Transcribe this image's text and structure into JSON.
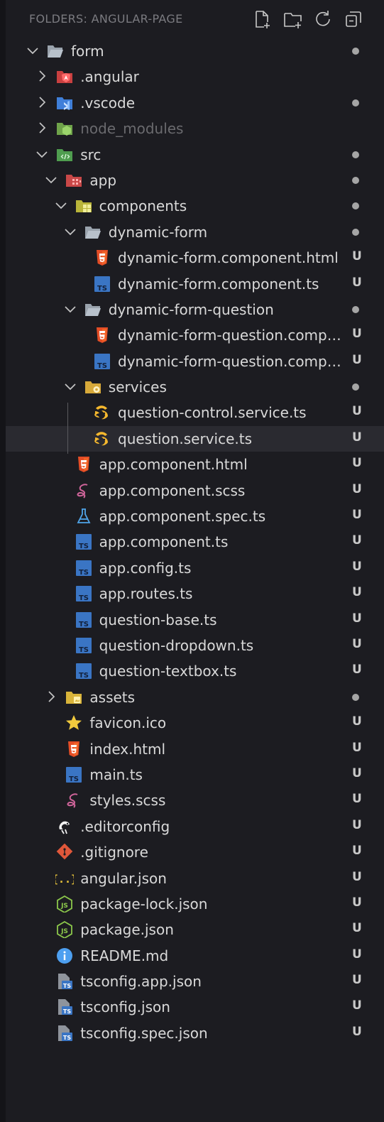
{
  "header": {
    "title": "FOLDERS: ANGULAR-PAGE",
    "buttons": [
      "new-file-icon",
      "new-folder-icon",
      "refresh-icon",
      "collapse-all-icon"
    ]
  },
  "tree": [
    {
      "label": "form",
      "depth": 0,
      "type": "folder",
      "expanded": true,
      "icon": "folder-open-icon",
      "dot": true
    },
    {
      "label": ".angular",
      "depth": 1,
      "type": "folder",
      "expanded": false,
      "icon": "angular-folder-icon",
      "dot": false
    },
    {
      "label": ".vscode",
      "depth": 1,
      "type": "folder",
      "expanded": false,
      "icon": "vscode-folder-icon",
      "dot": true
    },
    {
      "label": "node_modules",
      "depth": 1,
      "type": "folder",
      "expanded": false,
      "icon": "node-folder-icon",
      "dot": false,
      "dim": true
    },
    {
      "label": "src",
      "depth": 1,
      "type": "folder",
      "expanded": true,
      "icon": "src-folder-icon",
      "dot": true
    },
    {
      "label": "app",
      "depth": 2,
      "type": "folder",
      "expanded": true,
      "icon": "app-folder-icon",
      "dot": true
    },
    {
      "label": "components",
      "depth": 3,
      "type": "folder",
      "expanded": true,
      "icon": "components-folder-icon",
      "dot": true
    },
    {
      "label": "dynamic-form",
      "depth": 4,
      "type": "folder",
      "expanded": true,
      "icon": "folder-open-icon",
      "dot": true
    },
    {
      "label": "dynamic-form.component.html",
      "depth": 5,
      "type": "file",
      "icon": "html-icon",
      "status": "U"
    },
    {
      "label": "dynamic-form.component.ts",
      "depth": 5,
      "type": "file",
      "icon": "ts-icon",
      "status": "U"
    },
    {
      "label": "dynamic-form-question",
      "depth": 4,
      "type": "folder",
      "expanded": true,
      "icon": "folder-open-icon",
      "dot": true
    },
    {
      "label": "dynamic-form-question.compo...",
      "depth": 5,
      "type": "file",
      "icon": "html-icon",
      "status": "U"
    },
    {
      "label": "dynamic-form-question.compo...",
      "depth": 5,
      "type": "file",
      "icon": "ts-icon",
      "status": "U"
    },
    {
      "label": "services",
      "depth": 4,
      "type": "folder",
      "expanded": true,
      "icon": "services-folder-icon",
      "dot": true
    },
    {
      "label": "question-control.service.ts",
      "depth": 5,
      "type": "file",
      "icon": "angular-service-icon",
      "status": "U"
    },
    {
      "label": "question.service.ts",
      "depth": 5,
      "type": "file",
      "icon": "angular-service-icon",
      "status": "U",
      "selected": true
    },
    {
      "label": "app.component.html",
      "depth": 3,
      "type": "file",
      "icon": "html-icon",
      "status": "U"
    },
    {
      "label": "app.component.scss",
      "depth": 3,
      "type": "file",
      "icon": "sass-icon",
      "status": "U"
    },
    {
      "label": "app.component.spec.ts",
      "depth": 3,
      "type": "file",
      "icon": "test-flask-icon",
      "status": "U"
    },
    {
      "label": "app.component.ts",
      "depth": 3,
      "type": "file",
      "icon": "ts-icon",
      "status": "U"
    },
    {
      "label": "app.config.ts",
      "depth": 3,
      "type": "file",
      "icon": "ts-icon",
      "status": "U"
    },
    {
      "label": "app.routes.ts",
      "depth": 3,
      "type": "file",
      "icon": "ts-icon",
      "status": "U"
    },
    {
      "label": "question-base.ts",
      "depth": 3,
      "type": "file",
      "icon": "ts-icon",
      "status": "U"
    },
    {
      "label": "question-dropdown.ts",
      "depth": 3,
      "type": "file",
      "icon": "ts-icon",
      "status": "U"
    },
    {
      "label": "question-textbox.ts",
      "depth": 3,
      "type": "file",
      "icon": "ts-icon",
      "status": "U"
    },
    {
      "label": "assets",
      "depth": 2,
      "type": "folder",
      "expanded": false,
      "icon": "assets-folder-icon",
      "dot": true
    },
    {
      "label": "favicon.ico",
      "depth": 2,
      "type": "file",
      "icon": "star-icon",
      "status": "U"
    },
    {
      "label": "index.html",
      "depth": 2,
      "type": "file",
      "icon": "html-icon",
      "status": "U"
    },
    {
      "label": "main.ts",
      "depth": 2,
      "type": "file",
      "icon": "ts-icon",
      "status": "U"
    },
    {
      "label": "styles.scss",
      "depth": 2,
      "type": "file",
      "icon": "sass-icon",
      "status": "U"
    },
    {
      "label": ".editorconfig",
      "depth": 1,
      "type": "file",
      "icon": "editorconfig-icon",
      "status": "U"
    },
    {
      "label": ".gitignore",
      "depth": 1,
      "type": "file",
      "icon": "git-icon",
      "status": "U"
    },
    {
      "label": "angular.json",
      "depth": 1,
      "type": "file",
      "icon": "json-icon",
      "status": "U"
    },
    {
      "label": "package-lock.json",
      "depth": 1,
      "type": "file",
      "icon": "nodejs-icon",
      "status": "U"
    },
    {
      "label": "package.json",
      "depth": 1,
      "type": "file",
      "icon": "nodejs-icon",
      "status": "U"
    },
    {
      "label": "README.md",
      "depth": 1,
      "type": "file",
      "icon": "info-icon",
      "status": "U"
    },
    {
      "label": "tsconfig.app.json",
      "depth": 1,
      "type": "file",
      "icon": "tsconfig-icon",
      "status": "U"
    },
    {
      "label": "tsconfig.json",
      "depth": 1,
      "type": "file",
      "icon": "tsconfig-icon",
      "status": "U"
    },
    {
      "label": "tsconfig.spec.json",
      "depth": 1,
      "type": "file",
      "icon": "tsconfig-icon",
      "status": "U"
    }
  ]
}
